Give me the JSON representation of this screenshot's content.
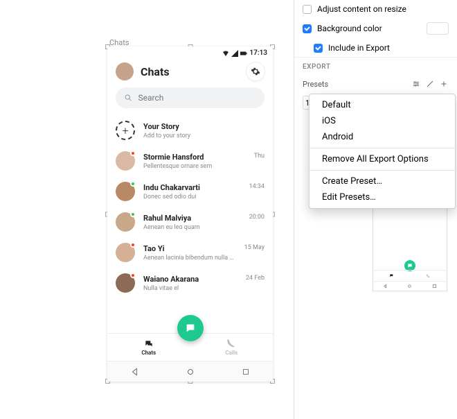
{
  "canvas": {
    "layer_label": "Chats"
  },
  "statusbar": {
    "time": "17:13"
  },
  "header": {
    "title": "Chats"
  },
  "search": {
    "placeholder": "Search"
  },
  "story": {
    "title": "Your Story",
    "subtitle": "Add to your story",
    "plus": "+"
  },
  "chats": [
    {
      "name": "Stormie Hansford",
      "sub": "Pellentesque ornare sem",
      "time": "Thu",
      "avatar_color": "#d9b9a3",
      "dot": "red"
    },
    {
      "name": "Indu Chakarvarti",
      "sub": "Donec sed odio dui",
      "time": "14:34",
      "avatar_color": "#b88964",
      "dot": "green"
    },
    {
      "name": "Rahul Malviya",
      "sub": "Aenean eu leo quam",
      "time": "20:00",
      "avatar_color": "#c9a889",
      "dot": "green"
    },
    {
      "name": "Tao Yi",
      "sub": "Aenean lacinia bibendum nulla sed consectetur",
      "time": "15 May",
      "avatar_color": "#d6b095",
      "dot": "red"
    },
    {
      "name": "Waiano Akarana",
      "sub": "Nulla vitae el",
      "time": "24 Feb",
      "avatar_color": "#8c6a56",
      "dot": "red"
    }
  ],
  "tabs": {
    "chats": "Chats",
    "calls": "Calls"
  },
  "inspector": {
    "adjust": "Adjust content on resize",
    "bgcolor": "Background color",
    "include": "Include in Export",
    "export_head": "EXPORT",
    "presets_label": "Presets",
    "scale_value": "1"
  },
  "menu": {
    "default": "Default",
    "ios": "iOS",
    "android": "Android",
    "remove": "Remove All Export Options",
    "create": "Create Preset…",
    "edit": "Edit Presets…"
  }
}
